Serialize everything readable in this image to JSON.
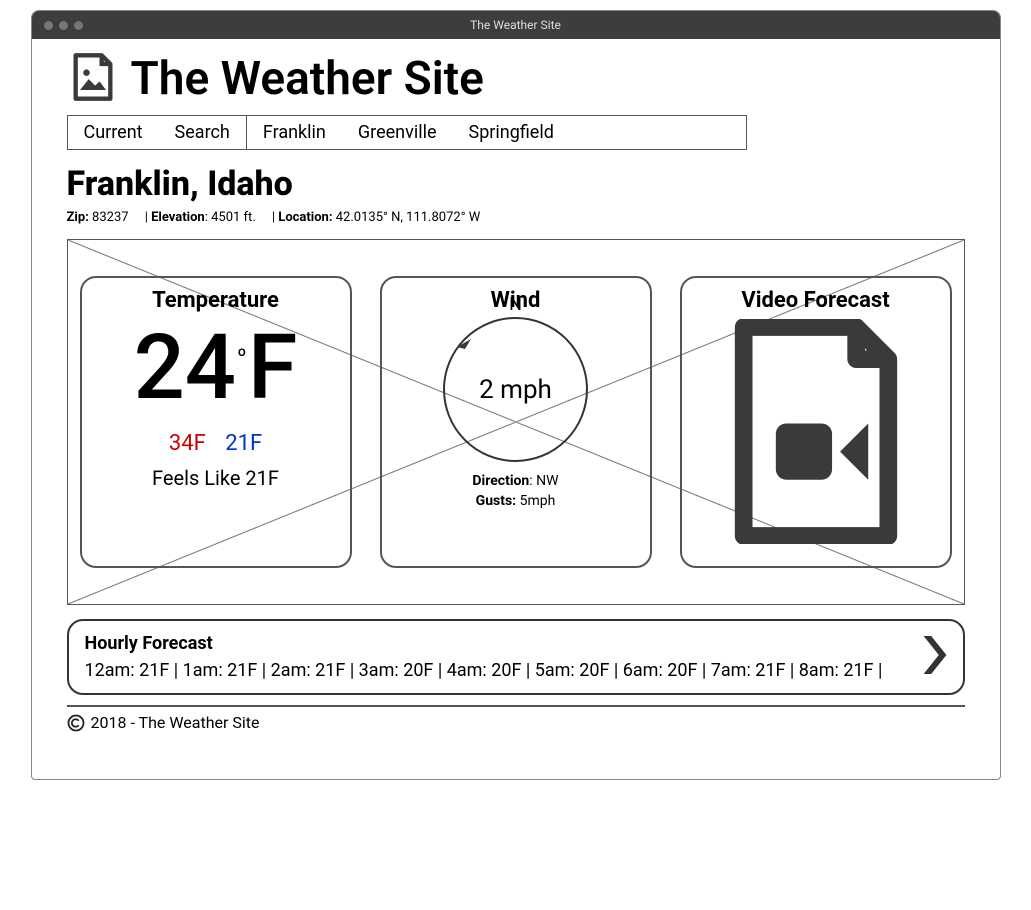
{
  "window": {
    "title": "The Weather Site"
  },
  "header": {
    "siteTitle": "The Weather Site"
  },
  "nav": {
    "group1": [
      "Current",
      "Search"
    ],
    "group2": [
      "Franklin",
      "Greenville",
      "Springfield"
    ]
  },
  "page": {
    "title": "Franklin, Idaho",
    "meta": {
      "zipLabel": "Zip:",
      "zipValue": " 83237",
      "sep1": "     | ",
      "elevLabel": "Elevation",
      "elevValue": ": 4501 ft.",
      "sep2": "     | ",
      "locLabel": "Location:",
      "locValue": " 42.0135° N, 111.8072° W"
    }
  },
  "temp": {
    "title": "Temperature",
    "value": "24",
    "deg": "o",
    "unit": "F",
    "high": "34F",
    "low": "21F",
    "feels": "Feels Like 21F"
  },
  "wind": {
    "title": "Wind",
    "north": "N",
    "speed": "2 mph",
    "dirLabel": "Direction",
    "dirValue": ": NW",
    "gustsLabel": "Gusts:",
    "gustsValue": " 5mph"
  },
  "video": {
    "title": "Video Forecast"
  },
  "hourly": {
    "title": "Hourly Forecast",
    "list": "12am: 21F  |  1am: 21F  |   2am: 21F |  3am: 20F  |   4am: 20F  |   5am: 20F  |   6am: 20F  |   7am:  21F  |   8am:  21F  |"
  },
  "footer": {
    "text": "2018 - The Weather Site"
  }
}
